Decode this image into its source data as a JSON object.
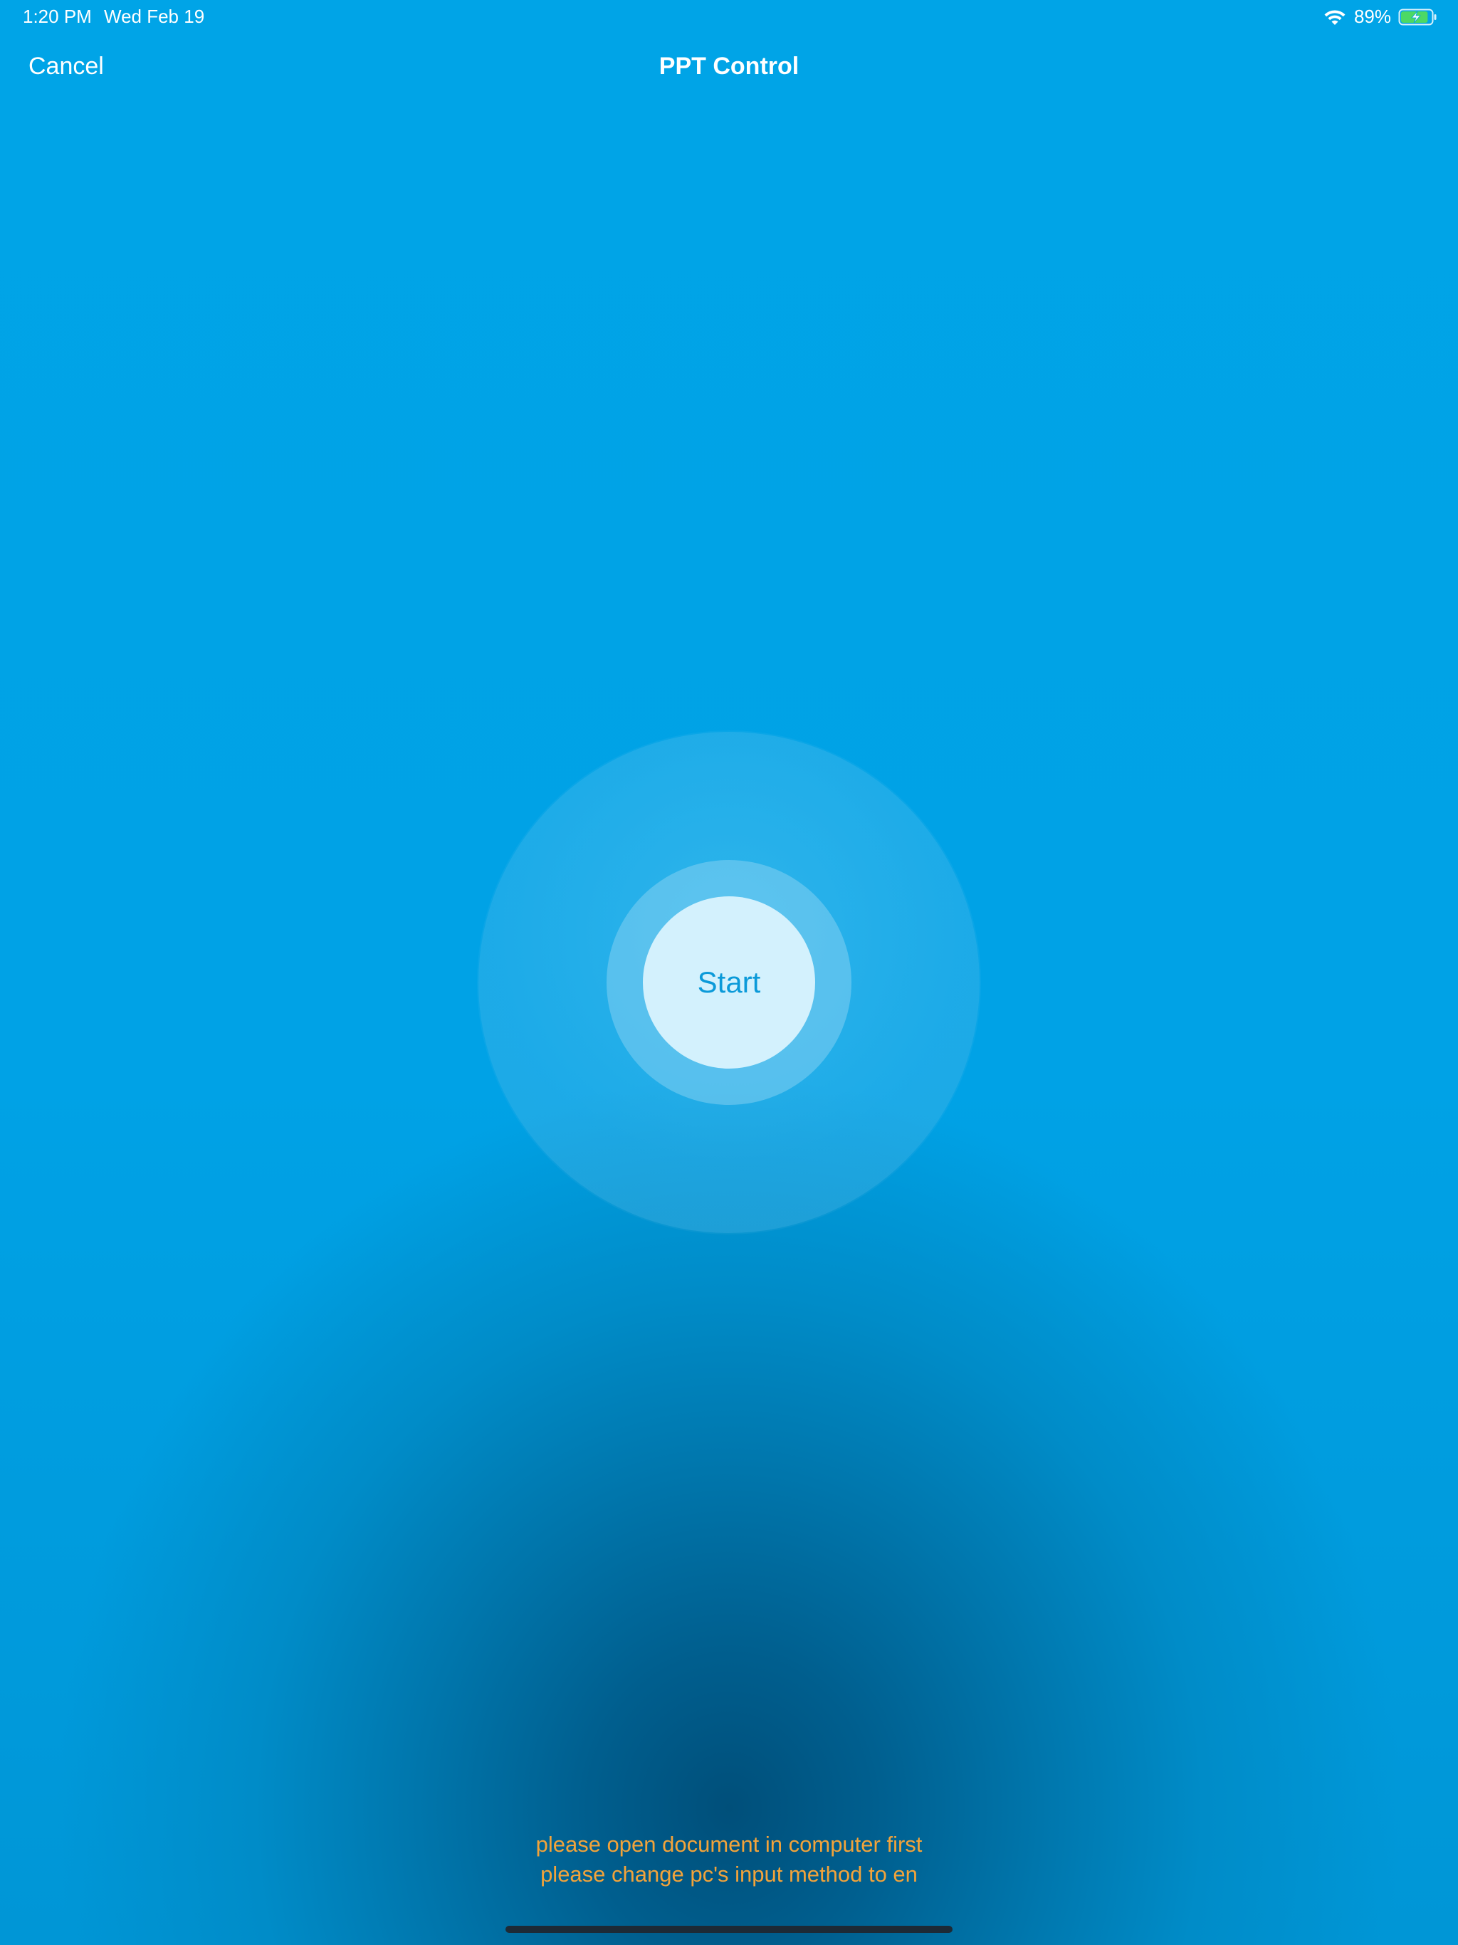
{
  "status_bar": {
    "time": "1:20 PM",
    "date": "Wed Feb 19",
    "battery_percent": "89%",
    "battery_level": 0.89,
    "charging": true,
    "wifi_icon": "wifi-icon",
    "battery_icon": "battery-charging-icon"
  },
  "nav": {
    "cancel_label": "Cancel",
    "title": "PPT Control"
  },
  "control": {
    "start_label": "Start"
  },
  "hints": {
    "line1": "please open document in computer first",
    "line2": "please change pc's input method to en"
  },
  "colors": {
    "background": "#00a2e6",
    "hint_text": "#f2a33a",
    "start_button_bg": "#d3f1fd",
    "start_button_text": "#0b9ad9",
    "battery_fill": "#4cd964"
  }
}
